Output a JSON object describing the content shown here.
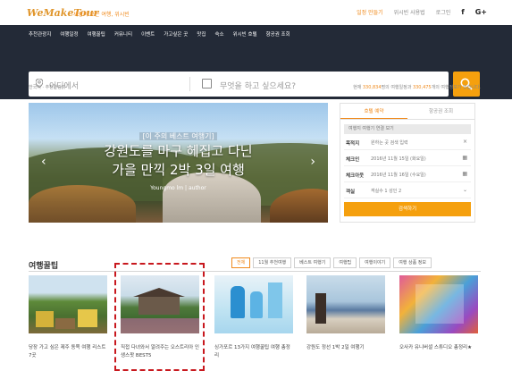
{
  "header": {
    "logo": "WeMakeTour",
    "tagline": "세상의 모든 여행, 위시빈",
    "links": [
      "일정 만들기",
      "위시빈 사용법",
      "로그인"
    ],
    "sns": [
      "f",
      "G+"
    ]
  },
  "nav": {
    "items": [
      "추천관광지",
      "여행일정",
      "여행꿀팁",
      "커뮤니티",
      "이벤트",
      "가고싶은 곳",
      "맛집",
      "숙소",
      "위시빈 호텔",
      "항공권 조회"
    ]
  },
  "search": {
    "where_placeholder": "어디에서",
    "what_placeholder": "무엇을 하고 싶으세요?"
  },
  "breadcrumb": "한국어 · 추천관광지",
  "stats": {
    "prefix": "현재 ",
    "users": "330,834",
    "mid": "명의 여행일정과 ",
    "places": "330,475",
    "suffix": "개의 여행정보가 있습니다."
  },
  "hero": {
    "subtitle": "[이 주의 베스트 여행기]",
    "title_line1": "강원도를 마구 헤집고 다닌",
    "title_line2": "가을 만끽 2박 3일 여행",
    "author": "Youngmo lm  |  author"
  },
  "booking": {
    "tabs": [
      "호텔 예약",
      "항공권 조회"
    ],
    "banner": "여행지 여행기 연결 보기",
    "rows": [
      {
        "label": "목적지",
        "value": "원하는 곳 검색 입력",
        "icon": "×"
      },
      {
        "label": "체크인",
        "value": "2016년 11월 15일 (화요일)",
        "icon": "▦"
      },
      {
        "label": "체크아웃",
        "value": "2016년 11월 16일 (수요일)",
        "icon": "▦"
      },
      {
        "label": "객실",
        "value": "객실수 1  성인 2",
        "icon": "⌄"
      }
    ],
    "button": "검색하기"
  },
  "tips": {
    "title": "여행꿀팁",
    "tabs": [
      "전체",
      "11월 추천여행",
      "베스트 여행기",
      "여행팁",
      "여행이야기",
      "여행 상품 정보"
    ],
    "cards": [
      {
        "caption": "당장 가고 싶은 제주 동쪽 여행 리스트 7곳"
      },
      {
        "caption": "직접 다녀와서 알려주는 오스트리아 인생스팟 BEST5"
      },
      {
        "caption": "싱가포르 13가지 여행꿀팁 여행 총정리"
      },
      {
        "caption": "강원도 정선 1박 2일 여행기"
      },
      {
        "caption": "오사카 유니버셜 스튜디오 총정리★"
      }
    ]
  },
  "colors": {
    "accent": "#f5a00e",
    "nav_bg": "#232a37",
    "highlight_box": "#c8181e"
  }
}
